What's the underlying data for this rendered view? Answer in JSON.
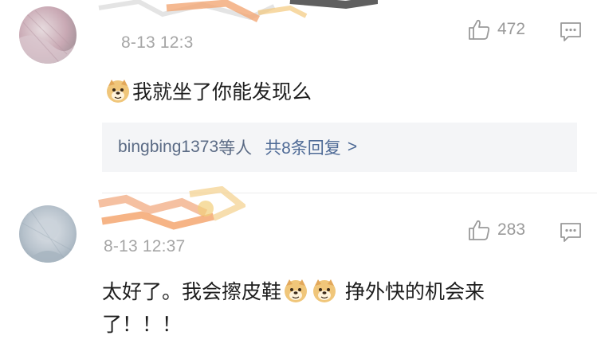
{
  "comments": [
    {
      "time": "8-13 12:3",
      "likes": "472",
      "text_before": "我就坐了你能发现么",
      "replies": {
        "who": "bingbing1373",
        "suffix": "等人",
        "total": "共8条回复",
        "arrow": ">"
      }
    },
    {
      "time": "8-13 12:37",
      "likes": "283",
      "text_line1_a": "太好了。我会擦皮鞋",
      "text_line1_b": "挣外快的机会来",
      "text_line2": "了！！！"
    }
  ],
  "icons": {
    "like": "thumbs-up-icon",
    "reply": "comment-bubble-icon",
    "emoji": "doge-emoji-icon"
  },
  "colors": {
    "meta_gray": "#9a9a9a",
    "link_blue": "#4e6a96",
    "reply_bg": "#f4f5f7"
  }
}
